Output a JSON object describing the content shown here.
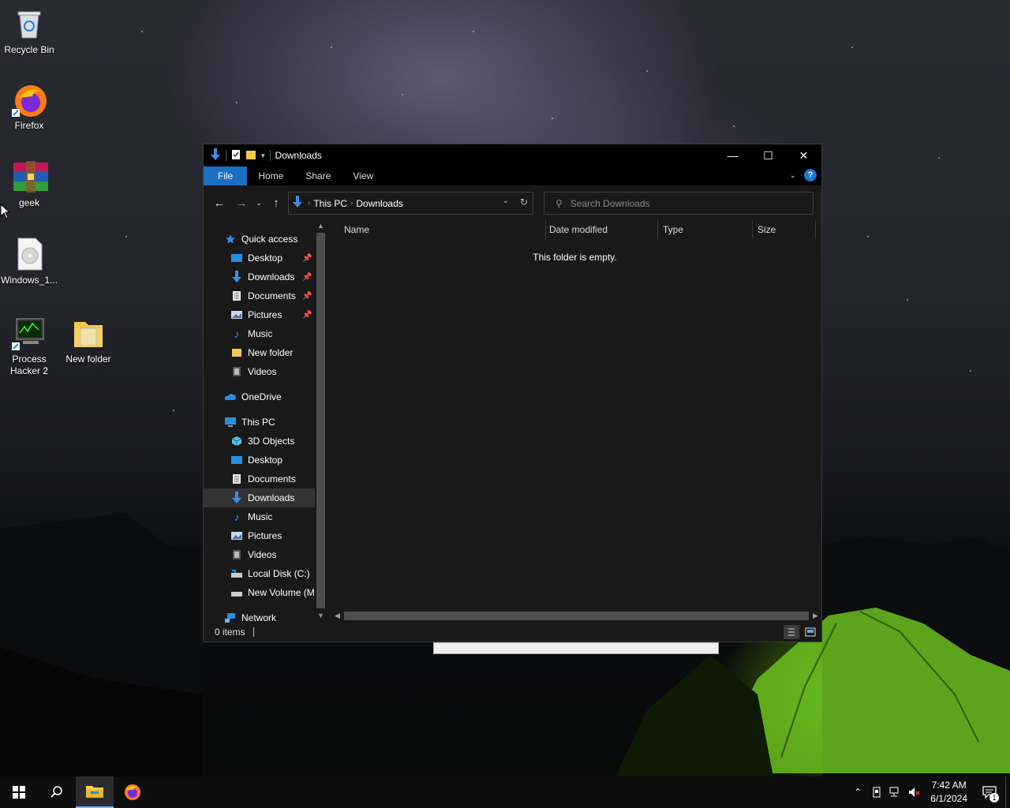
{
  "desktop": {
    "icons": [
      {
        "label": "Recycle Bin"
      },
      {
        "label": "Firefox"
      },
      {
        "label": "geek"
      },
      {
        "label": "Windows_1..."
      },
      {
        "label": "Process Hacker 2"
      },
      {
        "label": "New folder"
      }
    ]
  },
  "window": {
    "title": "Downloads",
    "ribbon_tabs": [
      "File",
      "Home",
      "Share",
      "View"
    ],
    "address": {
      "crumbs": [
        "This PC",
        "Downloads"
      ]
    },
    "search": {
      "placeholder": "Search Downloads"
    },
    "nav": {
      "quick_access": "Quick access",
      "quick_items": [
        "Desktop",
        "Downloads",
        "Documents",
        "Pictures",
        "Music",
        "New folder",
        "Videos"
      ],
      "onedrive": "OneDrive",
      "this_pc": "This PC",
      "pc_items": [
        "3D Objects",
        "Desktop",
        "Documents",
        "Downloads",
        "Music",
        "Pictures",
        "Videos",
        "Local Disk (C:)",
        "New Volume (M"
      ],
      "network": "Network",
      "selected": "Downloads"
    },
    "columns": [
      "Name",
      "Date modified",
      "Type",
      "Size"
    ],
    "empty_message": "This folder is empty.",
    "status": {
      "items": "0 items"
    }
  },
  "taskbar": {
    "time": "7:42 AM",
    "date": "6/1/2024",
    "notification_count": "1"
  },
  "colors": {
    "accent": "#1a6fc2",
    "window_bg": "#191919",
    "taskbar_bg": "#0e0e0e"
  }
}
